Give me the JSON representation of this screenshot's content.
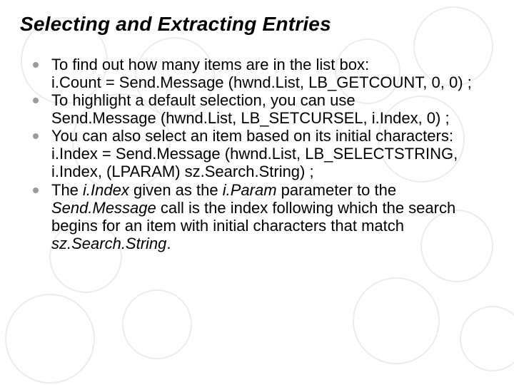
{
  "title": "Selecting and Extracting Entries",
  "bullets": [
    {
      "lead": "To find out how many items are in the list box:",
      "code": "i.Count = Send.Message (hwnd.List, LB_GETCOUNT, 0, 0) ;"
    },
    {
      "lead": "To highlight a default selection, you can use",
      "code": "Send.Message (hwnd.List, LB_SETCURSEL, i.Index, 0) ;"
    },
    {
      "lead": "You can also select an item based on its initial characters:",
      "code": "i.Index = Send.Message (hwnd.List, LB_SELECTSTRING, i.Index, (LPARAM) sz.Search.String) ;"
    },
    {
      "t1": "The ",
      "em1": "i.Index",
      "t2": " given as the ",
      "em2": "i.Param",
      "t3": " parameter to the ",
      "em3": "Send.Message",
      "t4": " call is the index following which the search begins for an item with initial characters that match ",
      "em4": "sz.Search.String",
      "t5": "."
    }
  ]
}
